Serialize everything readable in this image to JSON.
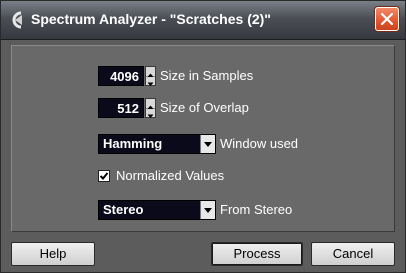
{
  "window": {
    "title": "Spectrum Analyzer - \"Scratches (2)\""
  },
  "settings": {
    "size_in_samples": {
      "value": "4096",
      "label": "Size in Samples"
    },
    "size_of_overlap": {
      "value": "512",
      "label": "Size of Overlap"
    },
    "window_used": {
      "value": "Hamming",
      "label": "Window used"
    },
    "normalized_values": {
      "checked": true,
      "label": "Normalized Values"
    },
    "from_stereo": {
      "value": "Stereo",
      "label": "From Stereo"
    }
  },
  "buttons": {
    "help": "Help",
    "process": "Process",
    "cancel": "Cancel"
  },
  "icons": {
    "app": "cubase-logo-icon",
    "close": "close-icon"
  },
  "colors": {
    "close_button": "#e35a33",
    "field_bg": "#0a0a1a",
    "panel_bg": "#696969"
  }
}
